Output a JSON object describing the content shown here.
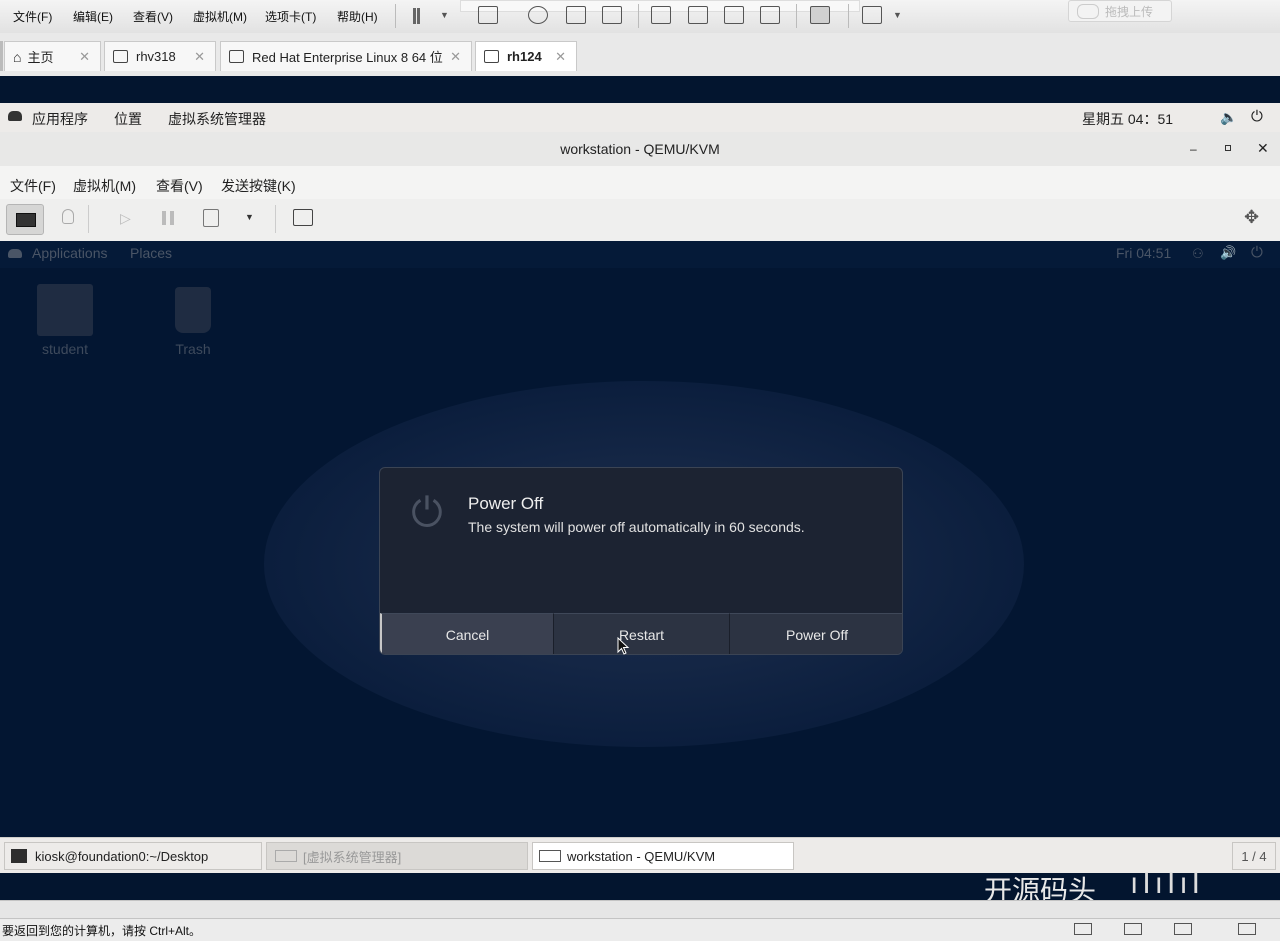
{
  "vmware_menu": [
    "文件(F)",
    "编辑(E)",
    "查看(V)",
    "虚拟机(M)",
    "选项卡(T)",
    "帮助(H)"
  ],
  "upload_label": "拖拽上传",
  "vmware_tabs": [
    {
      "label": "主页"
    },
    {
      "label": "rhv318"
    },
    {
      "label": "Red Hat Enterprise Linux 8 64 位"
    },
    {
      "label": "rh124"
    }
  ],
  "host_panel": {
    "apps": "应用程序",
    "places": "位置",
    "vmm": "虚拟系统管理器",
    "clock": "星期五 04：51"
  },
  "viewer": {
    "title": "workstation - QEMU/KVM",
    "menu": [
      "文件(F)",
      "虚拟机(M)",
      "查看(V)",
      "发送按键(K)"
    ]
  },
  "guest": {
    "applications": "Applications",
    "places": "Places",
    "clock": "Fri 04:51",
    "desktop_icons": [
      {
        "label": "student"
      },
      {
        "label": "Trash"
      }
    ]
  },
  "dialog": {
    "title": "Power Off",
    "message": "The system will power off automatically in 60 seconds.",
    "buttons": [
      "Cancel",
      "Restart",
      "Power Off"
    ]
  },
  "taskbar": {
    "items": [
      "kiosk@foundation0:~/Desktop",
      "[虚拟系统管理器]",
      "workstation - QEMU/KVM"
    ],
    "workspace": "1 / 4"
  },
  "watermark": "开源码头",
  "status_text": "要返回到您的计算机，请按 Ctrl+Alt。"
}
